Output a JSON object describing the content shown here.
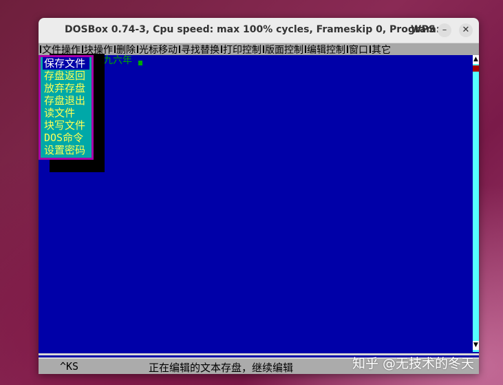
{
  "window": {
    "title": "DOSBox 0.74-3, Cpu speed: max 100% cycles, Frameskip  0, Program:",
    "program": "WPS",
    "minimize_glyph": "–",
    "close_glyph": "✕"
  },
  "menubar": {
    "items": [
      "文件操作",
      "块操作",
      "删除",
      "光标移动",
      "寻找替换",
      "打印控制",
      "版面控制",
      "编辑控制",
      "窗口",
      "其它"
    ]
  },
  "file_menu": {
    "selected_index": 0,
    "items": [
      "保存文件",
      "存盘返回",
      "放弃存盘",
      "存盘退出",
      "读文件",
      "块写文件",
      "DOS命令",
      "设置密码"
    ]
  },
  "document": {
    "text": "九九六年"
  },
  "scrollbar": {
    "up_glyph": "▲",
    "down_glyph": "▼"
  },
  "statusbar": {
    "key": "^KS",
    "message": "正在编辑的文本存盘，继续编辑"
  },
  "watermark": "知乎 @无技术的冬天",
  "colors": {
    "dos_blue": "#0000a8",
    "menu_cyan": "#00a8a8",
    "menu_border": "#a800a8",
    "menu_text": "#ffff55",
    "text_green": "#00a800",
    "bar_gray": "#a8a8a8"
  }
}
